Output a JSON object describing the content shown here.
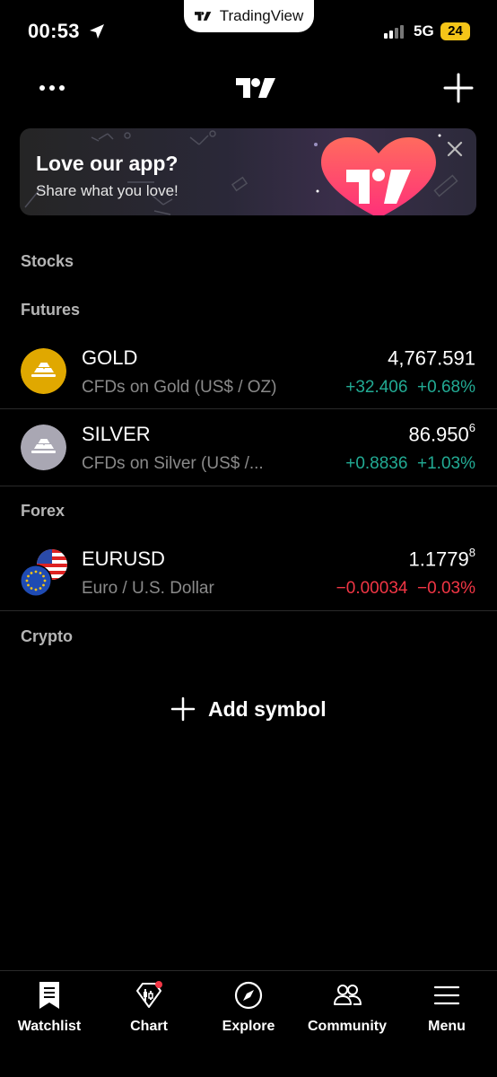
{
  "status_bar": {
    "time": "00:53",
    "app_pill": "TradingView",
    "network": "5G",
    "battery": "24"
  },
  "banner": {
    "title": "Love our app?",
    "subtitle": "Share what you love!"
  },
  "sections": {
    "stocks": "Stocks",
    "futures": "Futures",
    "forex": "Forex",
    "crypto": "Crypto"
  },
  "rows": [
    {
      "symbol": "GOLD",
      "description": "CFDs on Gold (US$ / OZ)",
      "price": "4,767.591",
      "price_sup": "",
      "change": "+32.406",
      "change_pct": "+0.68%",
      "color": "#22ab94",
      "icon": "gold-bars-icon"
    },
    {
      "symbol": "SILVER",
      "description": "CFDs on Silver (US$ /...",
      "price": "86.950",
      "price_sup": "6",
      "change": "+0.8836",
      "change_pct": "+1.03%",
      "color": "#22ab94",
      "icon": "silver-bars-icon"
    },
    {
      "symbol": "EURUSD",
      "description": "Euro / U.S. Dollar",
      "price": "1.1779",
      "price_sup": "8",
      "change": "−0.00034",
      "change_pct": "−0.03%",
      "color": "#f23645",
      "icon": "eu-us-flags-icon"
    }
  ],
  "add_symbol": "Add symbol",
  "tabs": [
    {
      "label": "Watchlist",
      "icon": "bookmark-list-icon"
    },
    {
      "label": "Chart",
      "icon": "chart-candles-icon"
    },
    {
      "label": "Explore",
      "icon": "compass-icon"
    },
    {
      "label": "Community",
      "icon": "people-icon"
    },
    {
      "label": "Menu",
      "icon": "hamburger-icon"
    }
  ],
  "colors": {
    "positive": "#22ab94",
    "negative": "#f23645",
    "battery": "#f5c518",
    "gold": "#e0a800"
  }
}
